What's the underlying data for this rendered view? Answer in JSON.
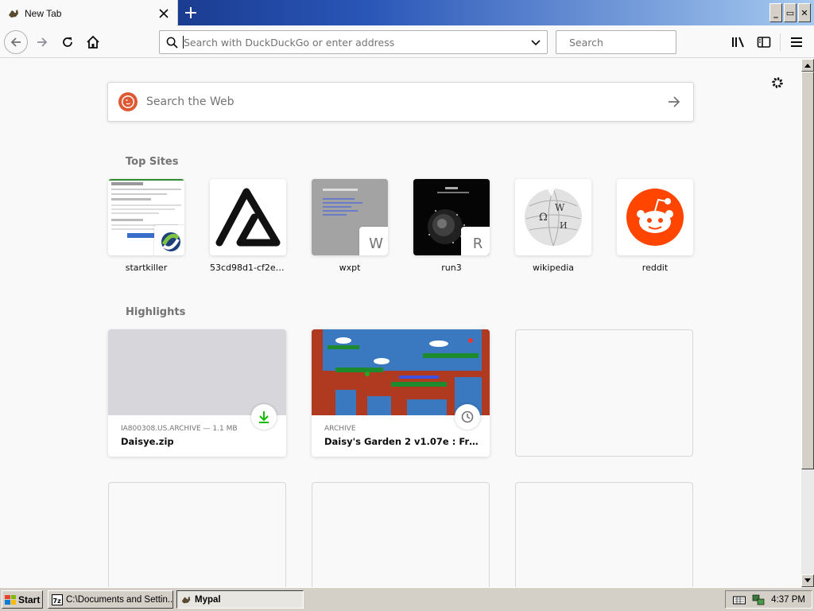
{
  "window": {
    "tab_title": "New Tab",
    "buttons": [
      "minimize",
      "restore",
      "close"
    ],
    "minimize_glyph": "_",
    "restore_glyph": "▭",
    "close_glyph": "✕"
  },
  "navbar": {
    "url_placeholder": "Search with DuckDuckGo or enter address",
    "search_placeholder": "Search"
  },
  "newtab": {
    "websearch_placeholder": "Search the Web",
    "top_sites_title": "Top Sites",
    "top_sites": [
      {
        "label": "startkiller"
      },
      {
        "label": "53cd98d1-cf2e-4..."
      },
      {
        "label": "wxpt",
        "letter": "W"
      },
      {
        "label": "run3",
        "letter": "R"
      },
      {
        "label": "wikipedia"
      },
      {
        "label": "reddit"
      }
    ],
    "highlights_title": "Highlights",
    "highlights": [
      {
        "meta": "IA800308.US.ARCHIVE — 1.1 MB",
        "title": "Daisye.zip",
        "badge": "download-icon"
      },
      {
        "meta": "ARCHIVE",
        "title": "Daisy's Garden 2 v1.07e : Frank ...",
        "badge": "clock-icon"
      }
    ]
  },
  "taskbar": {
    "start_label": "Start",
    "tasks": [
      {
        "label": "C:\\Documents and Settin..."
      },
      {
        "label": "Mypal"
      }
    ],
    "clock": "4:37 PM"
  },
  "colors": {
    "accent": "#0a84ff",
    "ddg_orange": "#de5833",
    "reddit_orange": "#ff4500",
    "download_green": "#12bc00"
  }
}
